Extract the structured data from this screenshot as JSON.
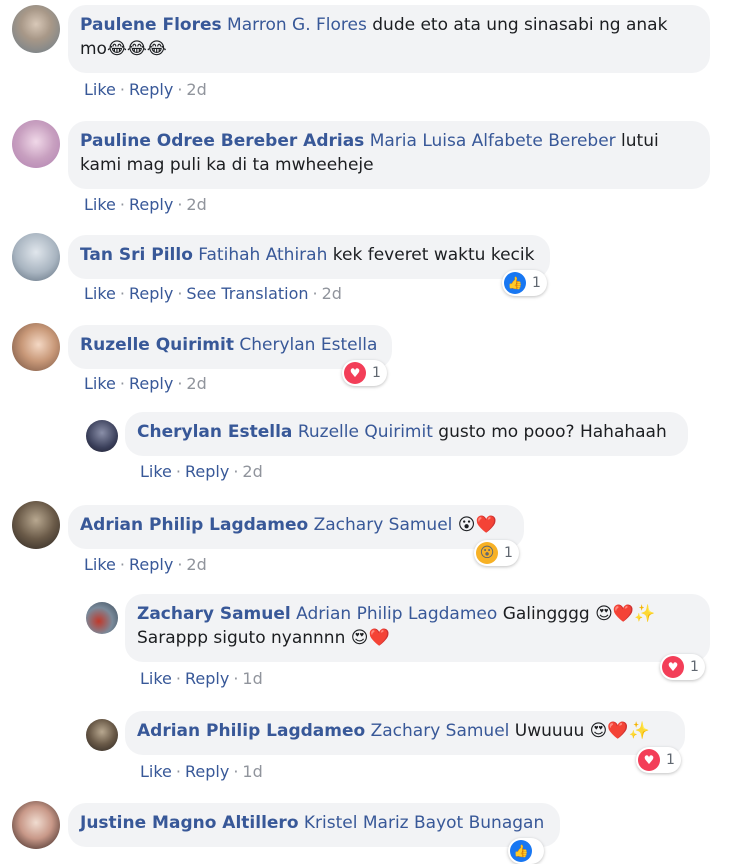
{
  "actions": {
    "like": "Like",
    "reply": "Reply",
    "see_translation": "See Translation"
  },
  "comments": [
    {
      "author": "Paulene Flores",
      "tag": "Marron G. Flores",
      "text": "dude eto ata ung sinasabi ng anak",
      "text2": "mo",
      "time": "2d"
    },
    {
      "author": "Pauline Odree Bereber Adrias",
      "tag": "Maria Luisa Alfabete Bereber",
      "text": "lutui",
      "text2": "kami mag puli ka di ta mwheeheje",
      "time": "2d"
    },
    {
      "author": "Tan Sri Pillo",
      "tag": "Fatihah Athirah",
      "text": "kek feveret waktu kecik",
      "time": "2d",
      "reaction_count": "1"
    },
    {
      "author": "Ruzelle Quirimit",
      "tag": "Cherylan Estella",
      "text": "",
      "time": "2d",
      "reaction_count": "1"
    },
    {
      "author": "Cherylan Estella",
      "tag": "Ruzelle Quirimit",
      "text": "gusto mo pooo? Hahahaah",
      "time": "2d"
    },
    {
      "author": "Adrian Philip Lagdameo",
      "tag": "Zachary Samuel",
      "text": "",
      "time": "2d",
      "reaction_count": "1"
    },
    {
      "author": "Zachary Samuel",
      "tag": "Adrian Philip Lagdameo",
      "text": "Galingggg",
      "text2": "Sarappp siguto nyannnn",
      "time": "1d",
      "reaction_count": "1"
    },
    {
      "author": "Adrian Philip Lagdameo",
      "tag": "Zachary Samuel",
      "text": "Uwuuuu",
      "time": "1d",
      "reaction_count": "1"
    },
    {
      "author": "Justine Magno Altillero",
      "tag": "Kristel Mariz Bayot Bunagan",
      "text": ""
    }
  ],
  "colors": {
    "link": "#385898",
    "bubble": "#f2f3f5",
    "meta": "#90949c",
    "like_blue": "#1877f2",
    "love_red": "#f33e58"
  }
}
